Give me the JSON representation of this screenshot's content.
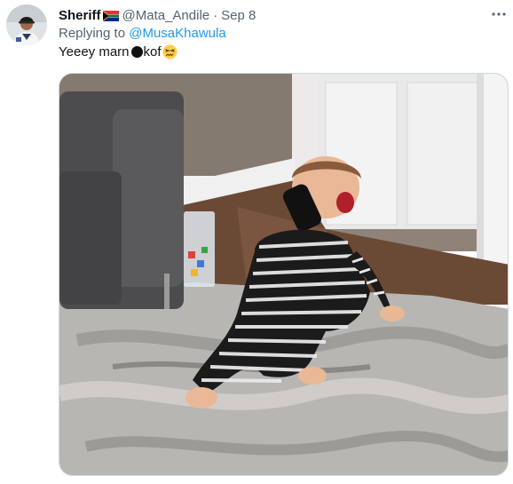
{
  "tweet": {
    "author": {
      "display_name": "Sheriff",
      "flag": "south-africa-flag",
      "handle": "@Mata_Andile",
      "separator": "·",
      "timestamp": "Sep 8"
    },
    "reply": {
      "prefix": "Replying to ",
      "mention": "@MusaKhawula"
    },
    "text": {
      "before": "Yeeey marn",
      "after": "kof",
      "censor_icon": "black-circle",
      "emoji": "confounded-face-emoji"
    },
    "media": {
      "type": "photo"
    },
    "more_icon": "more-horizontal-icon"
  },
  "colors": {
    "link": "#1d9bf0",
    "secondary_text": "#536471",
    "primary_text": "#0f1419",
    "border": "#cfd9de"
  }
}
